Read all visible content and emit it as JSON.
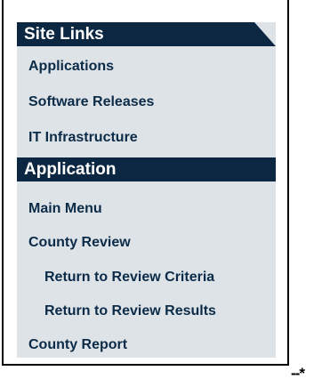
{
  "sections": [
    {
      "title": "Site Links",
      "items": [
        "Applications",
        "Software Releases",
        "IT Infrastructure"
      ]
    },
    {
      "title": "Application",
      "items": [
        "Main Menu",
        "County Review",
        "Return to Review Criteria",
        "Return to Review Results",
        "County Report"
      ]
    }
  ],
  "marker": "--*"
}
